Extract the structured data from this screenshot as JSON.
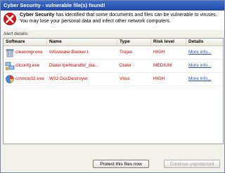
{
  "window": {
    "title": "Cyber Security - vulnerable file(s) found!"
  },
  "header": {
    "message_bold": "Cyber Security",
    "message_rest": " has identified that some documents and files can be vulnerable to viruses. You may lose your personal data and infect other network computers."
  },
  "alert_label": "Alert details:",
  "table": {
    "columns": [
      "Software",
      "Name",
      "Type",
      "Risk level",
      "Details"
    ],
    "rows": [
      {
        "software": "cleanmgr.exe",
        "name": "Infostealer.Banker.t",
        "type": "Trojan",
        "risk": "HIGH",
        "details": "More info...",
        "icon": "trash-can-icon"
      },
      {
        "software": "cliconfg.exe",
        "name": "Dialer.Ipehbandbz_dia...",
        "type": "Dialer",
        "risk": "MEDIUM",
        "details": "More info...",
        "icon": "network-icon"
      },
      {
        "software": "cmmon32.exe",
        "name": "W32.DocDestroyer",
        "type": "Virus",
        "risk": "HIGH",
        "details": "More info...",
        "icon": "pie-chart-icon"
      }
    ]
  },
  "buttons": {
    "protect": "Protect this files now",
    "continue": "Continue unprotected"
  }
}
